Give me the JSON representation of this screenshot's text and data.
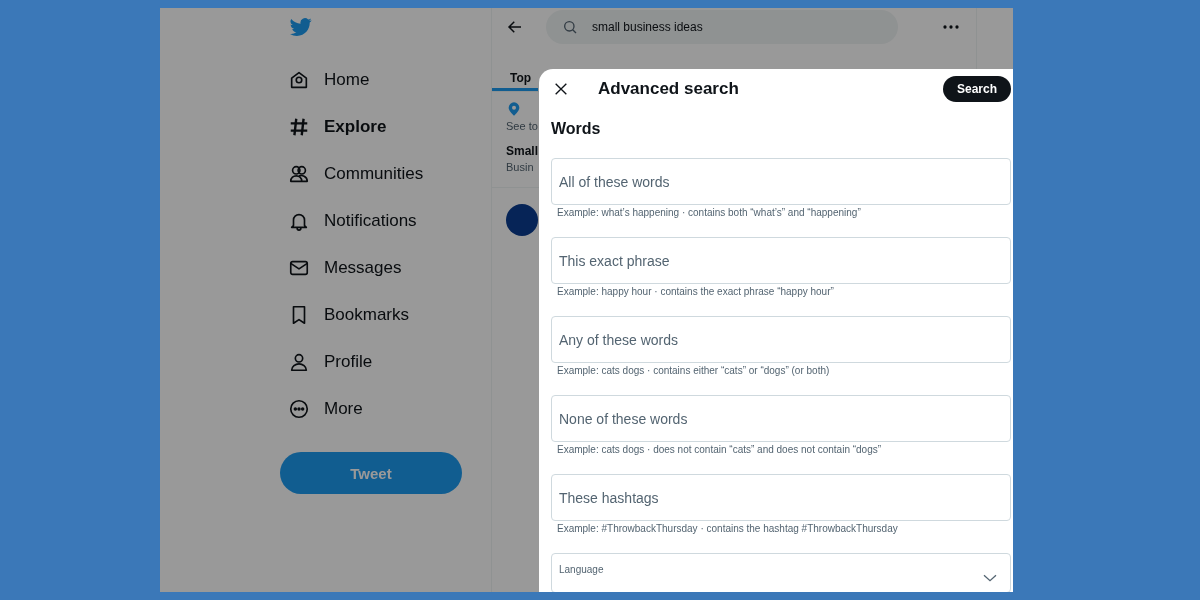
{
  "sidebar": {
    "items": [
      {
        "label": "Home",
        "selected": false
      },
      {
        "label": "Explore",
        "selected": true
      },
      {
        "label": "Communities",
        "selected": false
      },
      {
        "label": "Notifications",
        "selected": false
      },
      {
        "label": "Messages",
        "selected": false
      },
      {
        "label": "Bookmarks",
        "selected": false
      },
      {
        "label": "Profile",
        "selected": false
      },
      {
        "label": "More",
        "selected": false
      }
    ],
    "tweet_button": "Tweet"
  },
  "search": {
    "value": "small business ideas"
  },
  "tabs": [
    {
      "label": "Top",
      "selected": true
    }
  ],
  "trends_header": {
    "subtitle": "See to"
  },
  "trend": {
    "title": "Small",
    "subtitle": "Busin"
  },
  "modal": {
    "title": "Advanced search",
    "search_button": "Search",
    "section": "Words",
    "fields": [
      {
        "placeholder": "All of these words",
        "hint": "Example: what’s happening · contains both “what’s” and “happening”"
      },
      {
        "placeholder": "This exact phrase",
        "hint": "Example: happy hour · contains the exact phrase “happy hour”"
      },
      {
        "placeholder": "Any of these words",
        "hint": "Example: cats dogs · contains either “cats” or “dogs” (or both)"
      },
      {
        "placeholder": "None of these words",
        "hint": "Example: cats dogs · does not contain “cats” and does not contain “dogs”"
      },
      {
        "placeholder": "These hashtags",
        "hint": "Example: #ThrowbackThursday · contains the hashtag #ThrowbackThursday"
      }
    ],
    "language_label": "Language"
  }
}
